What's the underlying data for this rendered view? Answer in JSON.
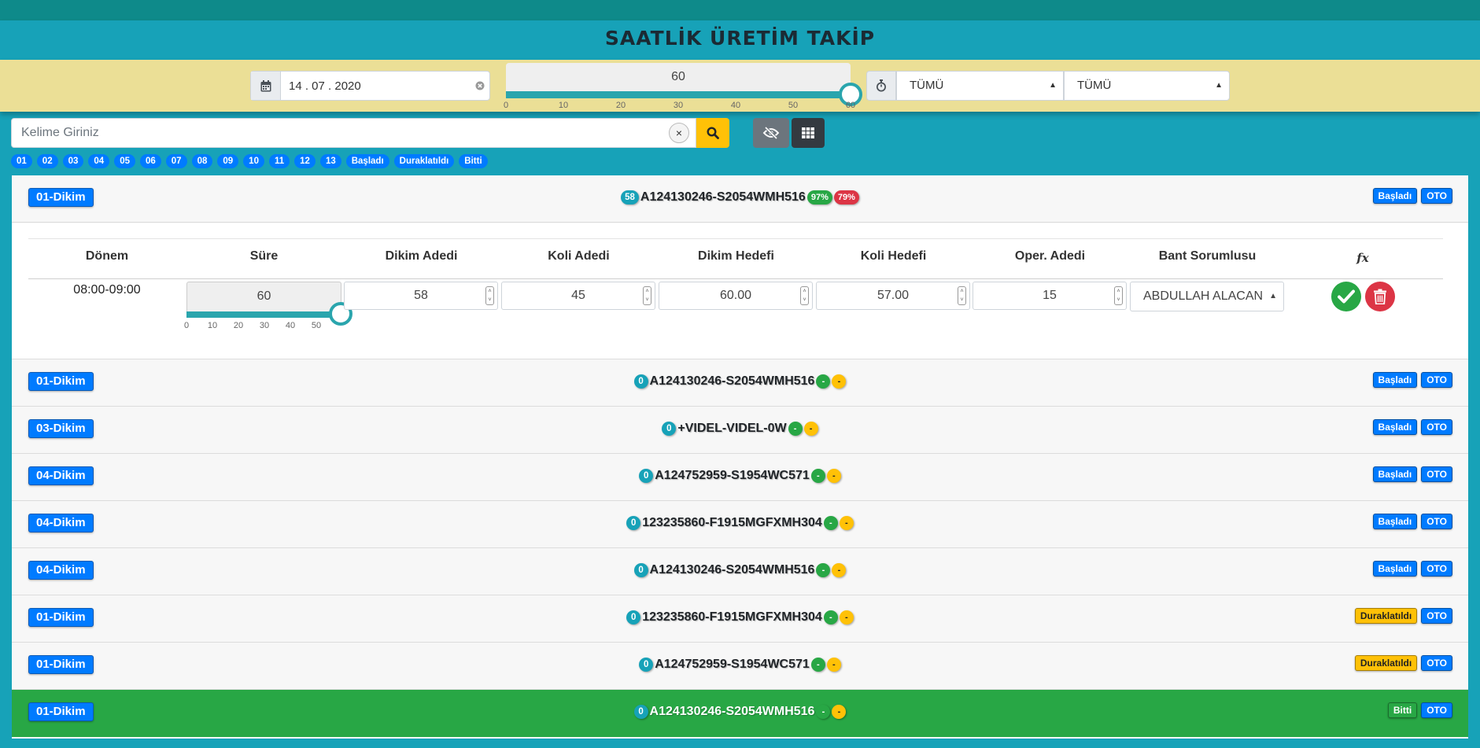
{
  "header": {
    "title": "SAATLİK ÜRETİM TAKİP"
  },
  "filters": {
    "date": "14 . 07 . 2020",
    "slider_value": "60",
    "scale": [
      "0",
      "10",
      "20",
      "30",
      "40",
      "50",
      "60"
    ],
    "select1": "TÜMÜ",
    "select2": "TÜMÜ"
  },
  "search": {
    "placeholder": "Kelime Giriniz",
    "clear": "×"
  },
  "chips": [
    "01",
    "02",
    "03",
    "04",
    "05",
    "06",
    "07",
    "08",
    "09",
    "10",
    "11",
    "12",
    "13",
    "Başladı",
    "Duraklatıldı",
    "Bitti"
  ],
  "detail": {
    "headers": [
      "Dönem",
      "Süre",
      "Dikim Adedi",
      "Koli Adedi",
      "Dikim Hedefi",
      "Koli Hedefi",
      "Oper. Adedi",
      "Bant Sorumlusu",
      "fx"
    ],
    "period": "08:00-09:00",
    "sure": "60",
    "sure_scale": [
      "0",
      "10",
      "20",
      "30",
      "40",
      "50"
    ],
    "dikim_adedi": "58",
    "koli_adedi": "45",
    "dikim_hedefi": "60.00",
    "koli_hedefi": "57.00",
    "oper_adedi": "15",
    "bant_sorumlusu": "ABDULLAH ALACAN"
  },
  "rows": [
    {
      "tag": "01-Dikim",
      "count": "58",
      "code": "A124130246-S2054WMH516",
      "p1": "97%",
      "p2": "79%",
      "status": "Başladı",
      "mode": "OTO"
    },
    {
      "tag": "01-Dikim",
      "count": "0",
      "code": "A124130246-S2054WMH516",
      "p1": "-",
      "p2": "-",
      "status": "Başladı",
      "mode": "OTO"
    },
    {
      "tag": "03-Dikim",
      "count": "0",
      "code": "+VIDEL-VIDEL-0W",
      "p1": "-",
      "p2": "-",
      "status": "Başladı",
      "mode": "OTO"
    },
    {
      "tag": "04-Dikim",
      "count": "0",
      "code": "A124752959-S1954WC571",
      "p1": "-",
      "p2": "-",
      "status": "Başladı",
      "mode": "OTO"
    },
    {
      "tag": "04-Dikim",
      "count": "0",
      "code": "123235860-F1915MGFXMH304",
      "p1": "-",
      "p2": "-",
      "status": "Başladı",
      "mode": "OTO"
    },
    {
      "tag": "04-Dikim",
      "count": "0",
      "code": "A124130246-S2054WMH516",
      "p1": "-",
      "p2": "-",
      "status": "Başladı",
      "mode": "OTO"
    },
    {
      "tag": "01-Dikim",
      "count": "0",
      "code": "123235860-F1915MGFXMH304",
      "p1": "-",
      "p2": "-",
      "status": "Duraklatıldı",
      "mode": "OTO"
    },
    {
      "tag": "01-Dikim",
      "count": "0",
      "code": "A124752959-S1954WC571",
      "p1": "-",
      "p2": "-",
      "status": "Duraklatıldı",
      "mode": "OTO"
    },
    {
      "tag": "01-Dikim",
      "count": "0",
      "code": "A124130246-S2054WMH516",
      "p1": "-",
      "p2": "-",
      "status": "Bitti",
      "mode": "OTO"
    }
  ]
}
